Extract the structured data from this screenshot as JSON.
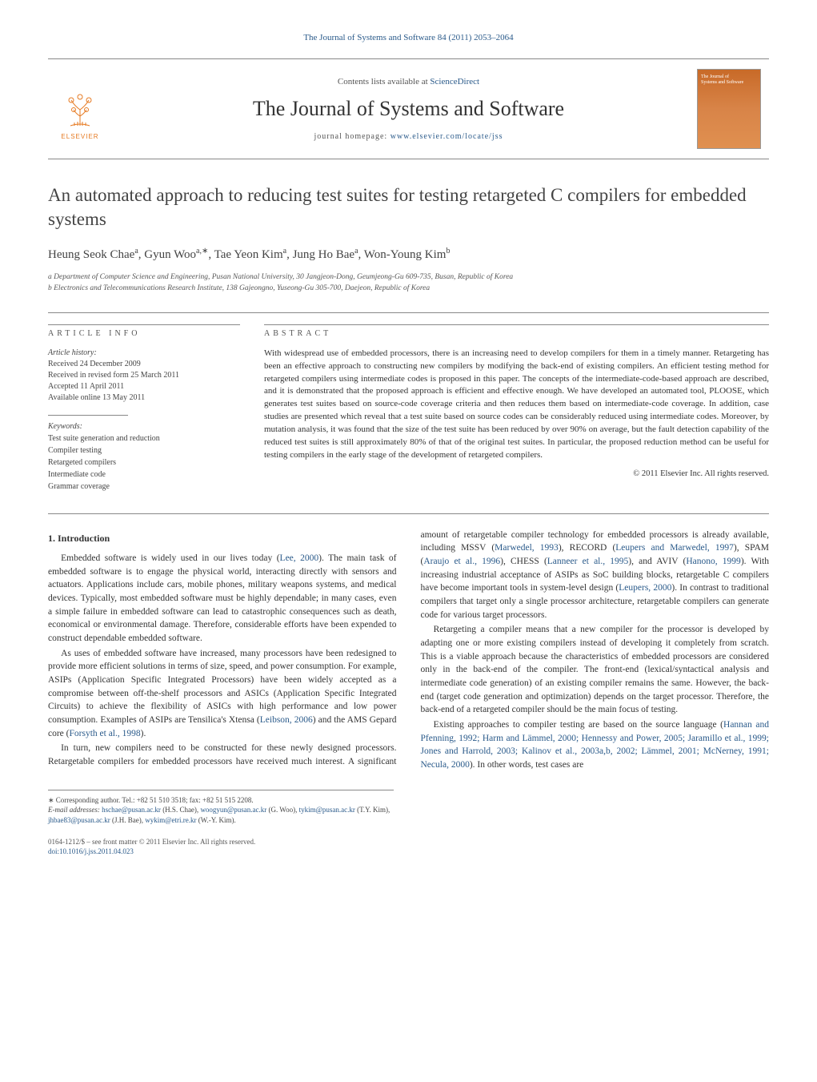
{
  "header_ref": "The Journal of Systems and Software 84 (2011) 2053–2064",
  "masthead": {
    "publisher_label": "ELSEVIER",
    "contents_prefix": "Contents lists available at ",
    "contents_link": "ScienceDirect",
    "journal_name": "The Journal of Systems and Software",
    "homepage_prefix": "journal homepage: ",
    "homepage_url": "www.elsevier.com/locate/jss"
  },
  "article": {
    "title": "An automated approach to reducing test suites for testing retargeted C compilers for embedded systems",
    "authors_html": "Heung Seok Chae<sup>a</sup>, Gyun Woo<sup>a,∗</sup>, Tae Yeon Kim<sup>a</sup>, Jung Ho Bae<sup>a</sup>, Won-Young Kim<sup>b</sup>",
    "affiliations": {
      "a": "a Department of Computer Science and Engineering, Pusan National University, 30 Jangjeon-Dong, Geumjeong-Gu 609-735, Busan, Republic of Korea",
      "b": "b Electronics and Telecommunications Research Institute, 138 Gajeongno, Yuseong-Gu 305-700, Daejeon, Republic of Korea"
    }
  },
  "info": {
    "section_label": "ARTICLE INFO",
    "history_label": "Article history:",
    "history": [
      "Received 24 December 2009",
      "Received in revised form 25 March 2011",
      "Accepted 11 April 2011",
      "Available online 13 May 2011"
    ],
    "keywords_label": "Keywords:",
    "keywords": [
      "Test suite generation and reduction",
      "Compiler testing",
      "Retargeted compilers",
      "Intermediate code",
      "Grammar coverage"
    ]
  },
  "abstract": {
    "section_label": "ABSTRACT",
    "text": "With widespread use of embedded processors, there is an increasing need to develop compilers for them in a timely manner. Retargeting has been an effective approach to constructing new compilers by modifying the back-end of existing compilers. An efficient testing method for retargeted compilers using intermediate codes is proposed in this paper. The concepts of the intermediate-code-based approach are described, and it is demonstrated that the proposed approach is efficient and effective enough. We have developed an automated tool, PLOOSE, which generates test suites based on source-code coverage criteria and then reduces them based on intermediate-code coverage. In addition, case studies are presented which reveal that a test suite based on source codes can be considerably reduced using intermediate codes. Moreover, by mutation analysis, it was found that the size of the test suite has been reduced by over 90% on average, but the fault detection capability of the reduced test suites is still approximately 80% of that of the original test suites. In particular, the proposed reduction method can be useful for testing compilers in the early stage of the development of retargeted compilers.",
    "copyright": "© 2011 Elsevier Inc. All rights reserved."
  },
  "body": {
    "heading1": "1. Introduction",
    "p1": "Embedded software is widely used in our lives today (Lee, 2000). The main task of embedded software is to engage the physical world, interacting directly with sensors and actuators. Applications include cars, mobile phones, military weapons systems, and medical devices. Typically, most embedded software must be highly dependable; in many cases, even a simple failure in embedded software can lead to catastrophic consequences such as death, economical or environmental damage. Therefore, considerable efforts have been expended to construct dependable embedded software.",
    "p2": "As uses of embedded software have increased, many processors have been redesigned to provide more efficient solutions in terms of size, speed, and power consumption. For example, ASIPs (Application Specific Integrated Processors) have been widely accepted as a compromise between off-the-shelf processors and ASICs (Application Specific Integrated Circuits) to achieve the flexibility of ASICs with high performance and low power consumption. Examples of ASIPs are Tensilica's Xtensa (Leibson, 2006) and the AMS Gepard core (Forsyth et al., 1998).",
    "p3": "In turn, new compilers need to be constructed for these newly designed processors. Retargetable compilers for embedded processors have received much interest. A significant amount of retargetable compiler technology for embedded processors is already available, including MSSV (Marwedel, 1993), RECORD (Leupers and Marwedel, 1997), SPAM (Araujo et al., 1996), CHESS (Lanneer et al., 1995), and AVIV (Hanono, 1999). With increasing industrial acceptance of ASIPs as SoC building blocks, retargetable C compilers have become important tools in system-level design (Leupers, 2000). In contrast to traditional compilers that target only a single processor architecture, retargetable compilers can generate code for various target processors.",
    "p4": "Retargeting a compiler means that a new compiler for the processor is developed by adapting one or more existing compilers instead of developing it completely from scratch. This is a viable approach because the characteristics of embedded processors are considered only in the back-end of the compiler. The front-end (lexical/syntactical analysis and intermediate code generation) of an existing compiler remains the same. However, the back-end (target code generation and optimization) depends on the target processor. Therefore, the back-end of a retargeted compiler should be the main focus of testing.",
    "p5": "Existing approaches to compiler testing are based on the source language (Hannan and Pfenning, 1992; Harm and Lämmel, 2000; Hennessy and Power, 2005; Jaramillo et al., 1999; Jones and Harrold, 2003; Kalinov et al., 2003a,b, 2002; Lämmel, 2001; McNerney, 1991; Necula, 2000). In other words, test cases are"
  },
  "footnotes": {
    "corr": "∗ Corresponding author. Tel.: +82 51 510 3518; fax: +82 51 515 2208.",
    "emails_label": "E-mail addresses: ",
    "emails": "hschae@pusan.ac.kr (H.S. Chae), woogyun@pusan.ac.kr (G. Woo), tykim@pusan.ac.kr (T.Y. Kim), jhbae83@pusan.ac.kr (J.H. Bae), wykim@etri.re.kr (W.-Y. Kim)."
  },
  "bottom": {
    "issn": "0164-1212/$ – see front matter © 2011 Elsevier Inc. All rights reserved.",
    "doi": "doi:10.1016/j.jss.2011.04.023"
  }
}
